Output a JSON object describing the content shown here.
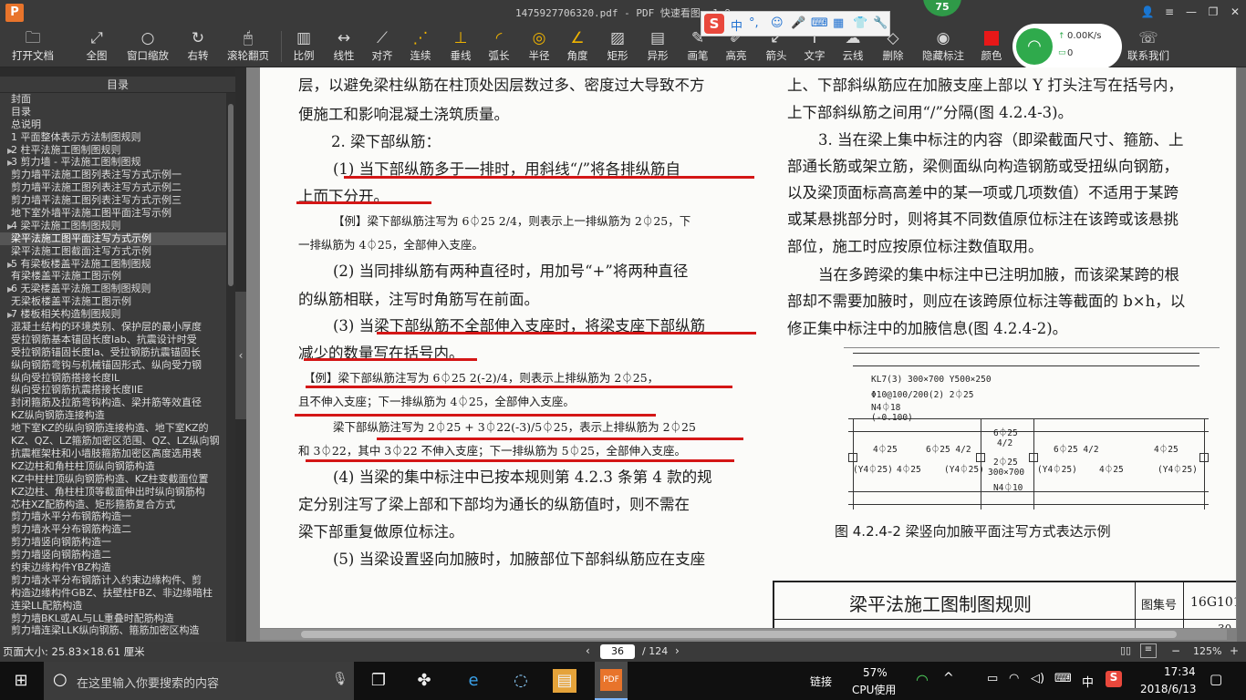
{
  "window": {
    "logo": "P",
    "title": "1475927706320.pdf - PDF 快速看图 v1.9",
    "badge": "75"
  },
  "toolbar": {
    "items": [
      {
        "label": "打开文档",
        "icon": "folder-icon"
      },
      {
        "label": "全图",
        "icon": "fit-icon"
      },
      {
        "label": "窗口缩放",
        "icon": "zoom-icon"
      },
      {
        "label": "右转",
        "icon": "rotate-icon"
      },
      {
        "label": "滚轮翻页",
        "icon": "mouse-icon"
      },
      {
        "label": "比例",
        "icon": "scale-icon"
      },
      {
        "label": "线性",
        "icon": "linear-icon"
      },
      {
        "label": "对齐",
        "icon": "align-icon"
      },
      {
        "label": "连续",
        "icon": "continuous-icon"
      },
      {
        "label": "垂线",
        "icon": "perpendicular-icon"
      },
      {
        "label": "弧长",
        "icon": "arc-icon"
      },
      {
        "label": "半径",
        "icon": "radius-icon"
      },
      {
        "label": "角度",
        "icon": "angle-icon"
      },
      {
        "label": "矩形",
        "icon": "rect-icon"
      },
      {
        "label": "异形",
        "icon": "polygon-icon"
      },
      {
        "label": "画笔",
        "icon": "pen-icon"
      },
      {
        "label": "高亮",
        "icon": "highlight-icon"
      },
      {
        "label": "箭头",
        "icon": "arrow-icon"
      },
      {
        "label": "文字",
        "icon": "text-icon"
      },
      {
        "label": "云线",
        "icon": "cloud-icon"
      },
      {
        "label": "删除",
        "icon": "eraser-icon"
      },
      {
        "label": "隐藏标注",
        "icon": "eye-icon"
      },
      {
        "label": "颜色",
        "icon": "color-icon"
      },
      {
        "label": "联系我们",
        "icon": "contact-icon"
      }
    ]
  },
  "ime": {
    "logo": "S",
    "mode": "中",
    "punct": "°,"
  },
  "wifi": {
    "speed": "0.00K/s",
    "count": "0"
  },
  "sidebar": {
    "title": "目录",
    "items": [
      {
        "label": "封面",
        "arrow": ""
      },
      {
        "label": "目录",
        "arrow": ""
      },
      {
        "label": "总说明",
        "arrow": ""
      },
      {
        "label": "1 平面整体表示方法制图规则",
        "arrow": ""
      },
      {
        "label": "2 柱平法施工图制图规则",
        "arrow": "▶"
      },
      {
        "label": "3 剪力墙 - 平法施工图制图规",
        "arrow": "▶"
      },
      {
        "label": "剪力墙平法施工图列表注写方式示例一",
        "arrow": ""
      },
      {
        "label": "剪力墙平法施工图列表注写方式示例二",
        "arrow": ""
      },
      {
        "label": "剪力墙平法施工图列表注写方式示例三",
        "arrow": ""
      },
      {
        "label": "地下室外墙平法施工图平面注写示例",
        "arrow": ""
      },
      {
        "label": "4 梁平法施工图制图规则",
        "arrow": "▶"
      },
      {
        "label": "梁平法施工图平面注写方式示例",
        "arrow": ""
      },
      {
        "label": "梁平法施工图截面注写方式示例",
        "arrow": ""
      },
      {
        "label": "5 有梁板楼盖平法施工图制图规",
        "arrow": "▶"
      },
      {
        "label": "有梁楼盖平法施工图示例",
        "arrow": ""
      },
      {
        "label": "6 无梁楼盖平法施工图制图规则",
        "arrow": "▶"
      },
      {
        "label": "无梁板楼盖平法施工图示例",
        "arrow": ""
      },
      {
        "label": "7 楼板相关构造制图规则",
        "arrow": "▶"
      },
      {
        "label": "混凝土结构的环境类别、保护层的最小厚度",
        "arrow": ""
      },
      {
        "label": "受拉钢筋基本锚固长度lab、抗震设计时受",
        "arrow": ""
      },
      {
        "label": "受拉钢筋锚固长度la、受拉钢筋抗震锚固长",
        "arrow": ""
      },
      {
        "label": "纵向钢筋弯钩与机械锚固形式、纵向受力钢",
        "arrow": ""
      },
      {
        "label": "纵向受拉钢筋搭接长度lL",
        "arrow": ""
      },
      {
        "label": "纵向受拉钢筋抗震搭接长度llE",
        "arrow": ""
      },
      {
        "label": "封闭箍筋及拉筋弯钩构造、梁并筋等效直径",
        "arrow": ""
      },
      {
        "label": "KZ纵向钢筋连接构造",
        "arrow": ""
      },
      {
        "label": "地下室KZ的纵向钢筋连接构造、地下室KZ的",
        "arrow": ""
      },
      {
        "label": "KZ、QZ、LZ箍筋加密区范围、QZ、LZ纵向钢",
        "arrow": ""
      },
      {
        "label": "抗震框架柱和小墙肢箍筋加密区高度选用表",
        "arrow": ""
      },
      {
        "label": "KZ边柱和角柱柱顶纵向钢筋构造",
        "arrow": ""
      },
      {
        "label": "KZ中柱柱顶纵向钢筋构造、KZ柱变截面位置",
        "arrow": ""
      },
      {
        "label": "KZ边柱、角柱柱顶等截面伸出时纵向钢筋构",
        "arrow": ""
      },
      {
        "label": "芯柱XZ配筋构造、矩形箍筋复合方式",
        "arrow": ""
      },
      {
        "label": "剪力墙水平分布钢筋构造一",
        "arrow": ""
      },
      {
        "label": "剪力墙水平分布钢筋构造二",
        "arrow": ""
      },
      {
        "label": "剪力墙竖向钢筋构造一",
        "arrow": ""
      },
      {
        "label": "剪力墙竖向钢筋构造二",
        "arrow": ""
      },
      {
        "label": "约束边缘构件YBZ构造",
        "arrow": ""
      },
      {
        "label": "剪力墙水平分布钢筋计入约束边缘构件、剪",
        "arrow": ""
      },
      {
        "label": "构造边缘构件GBZ、扶壁柱FBZ、非边缘暗柱",
        "arrow": ""
      },
      {
        "label": "连梁LL配筋构造",
        "arrow": ""
      },
      {
        "label": "剪力墙BKL或AL与LL重叠时配筋构造",
        "arrow": ""
      },
      {
        "label": "剪力墙连梁LLK纵向钢筋、箍筋加密区构造",
        "arrow": ""
      }
    ],
    "selected_index": 11
  },
  "document": {
    "left": [
      "层，以避免梁柱纵筋在柱顶处因层数过多、密度过大导致不方",
      "便施工和影响混凝土浇筑质量。",
      "2. 梁下部纵筋：",
      "(1) 当下部纵筋多于一排时，用斜线“/”将各排纵筋自",
      "上而下分开。",
      "【例】梁下部纵筋注写为 6⏀25 2/4，则表示上一排纵筋为 2⏀25，下",
      "一排纵筋为 4⏀25，全部伸入支座。",
      "(2) 当同排纵筋有两种直径时，用加号“+”将两种直径",
      "的纵筋相联，注写时角筋写在前面。",
      "(3) 当梁下部纵筋不全部伸入支座时，将梁支座下部纵筋",
      "减少的数量写在括号内。",
      "【例】梁下部纵筋注写为 6⏀25 2(-2)/4，则表示上排纵筋为 2⏀25，",
      "且不伸入支座；下一排纵筋为 4⏀25，全部伸入支座。",
      "梁下部纵筋注写为 2⏀25 + 3⏀22(-3)/5⏀25，表示上排纵筋为 2⏀25",
      "和 3⏀22，其中 3⏀22 不伸入支座；下一排纵筋为 5⏀25，全部伸入支座。",
      "(4) 当梁的集中标注中已按本规则第 4.2.3 条第 4 款的规",
      "定分别注写了梁上部和下部均为通长的纵筋值时，则不需在",
      "梁下部重复做原位标注。",
      "(5) 当梁设置竖向加腋时，加腋部位下部斜纵筋应在支座"
    ],
    "right": [
      "上、下部斜纵筋应在加腋支座上部以 Y 打头注写在括号内，",
      "上下部斜纵筋之间用“/”分隔(图 4.2.4-3)。",
      "3. 当在梁上集中标注的内容（即梁截面尺寸、箍筋、上",
      "部通长筋或架立筋，梁侧面纵向构造钢筋或受扭纵向钢筋，",
      "以及梁顶面标高高差中的某一项或几项数值）不适用于某跨",
      "或某悬挑部分时，则将其不同数值原位标注在该跨或该悬挑",
      "部位，施工时应按原位标注数值取用。",
      "当在多跨梁的集中标注中已注明加腋，而该梁某跨的根",
      "部却不需要加腋时，则应在该跨原位标注等截面的 b×h，以",
      "修正集中标注中的加腋信息(图 4.2.4-2)。"
    ],
    "figure": {
      "caption": "图 4.2.4-2 梁竖向加腋平面注写方式表达示例",
      "labels": [
        "KL7(3)  300×700 Y500×250",
        "Φ10@100/200(2) 2⏀25",
        "N4⏀18",
        "(-0.100)",
        "6⏀25",
        "4/2",
        "4⏀25",
        "6⏀25 4/2",
        "6⏀25 4/2",
        "4⏀25",
        "(Y4⏀25)",
        "4⏀25",
        "(Y4⏀25)",
        "2⏀25",
        "300×700",
        "N4⏀10",
        "(Y4⏀25)",
        "4⏀25",
        "(Y4⏀25)"
      ]
    },
    "titleblock": {
      "title": "梁平法施工图制图规则",
      "set_label": "图集号",
      "set_no": "16G101-",
      "page_no": "30"
    }
  },
  "statusbar": {
    "page_size": "页面大小: 25.83×18.61 厘米",
    "current_page": "36",
    "total_pages": "/ 124",
    "zoom": "125%"
  },
  "taskbar": {
    "search_placeholder": "在这里输入你要搜索的内容",
    "link_label": "链接",
    "cpu_percent": "57%",
    "cpu_label": "CPU使用",
    "lang": "中",
    "time": "17:34",
    "date": "2018/6/13"
  }
}
